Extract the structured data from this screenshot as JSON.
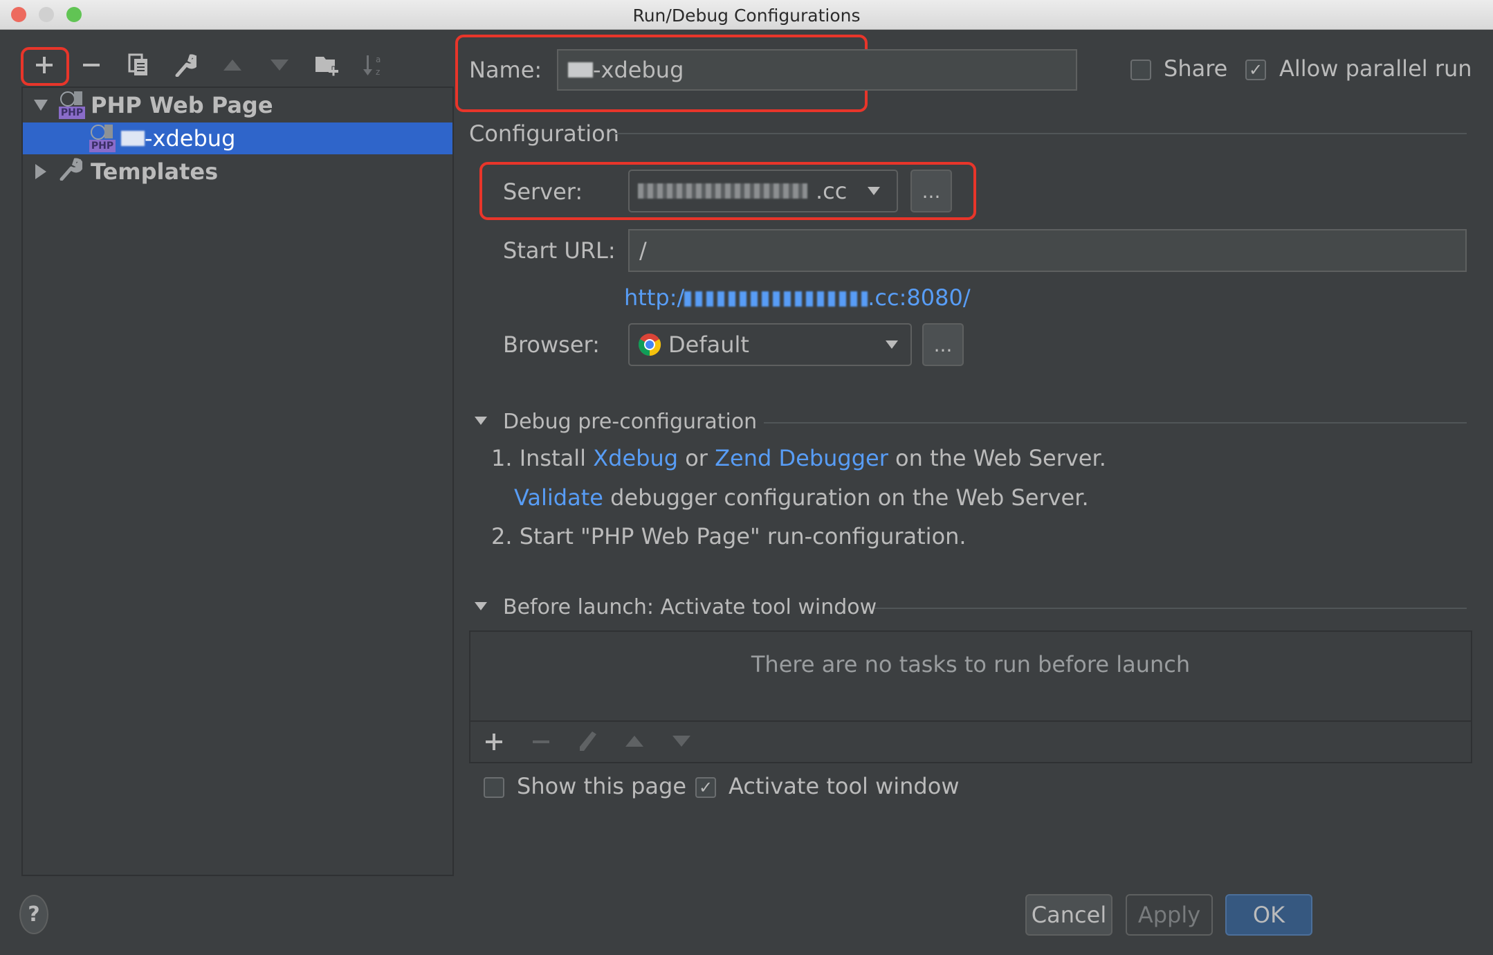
{
  "window": {
    "title": "Run/Debug Configurations",
    "traffic_lights": {
      "close": "#ed6a5e",
      "minimize": "#d0d0d0",
      "maximize": "#61c454"
    }
  },
  "toolbar": {
    "items": [
      {
        "name": "add",
        "glyph": "+"
      },
      {
        "name": "remove",
        "glyph": "−"
      },
      {
        "name": "copy",
        "glyph": "⧉"
      },
      {
        "name": "edit-defaults",
        "glyph": "🔧"
      },
      {
        "name": "move-up",
        "glyph": "▲"
      },
      {
        "name": "move-down",
        "glyph": "▼"
      },
      {
        "name": "new-folder",
        "glyph": "📁"
      },
      {
        "name": "sort",
        "glyph": "↓ᵃᶻ"
      }
    ]
  },
  "tree": {
    "group": {
      "label": "PHP Web Page",
      "expanded": true
    },
    "child": {
      "label": "-xdebug",
      "selected": true
    },
    "templates": {
      "label": "Templates",
      "expanded": false
    }
  },
  "form": {
    "name_label": "Name:",
    "name_value": "-xdebug",
    "share_label": "Share",
    "share_checked": false,
    "allow_parallel_label": "Allow parallel run",
    "allow_parallel_checked": true,
    "configuration_header": "Configuration",
    "server_label": "Server:",
    "server_value_suffix": ".cc",
    "ellipsis": "...",
    "start_url_label": "Start URL:",
    "start_url_value": "/",
    "resolved_url_prefix": "http:/",
    "resolved_url_suffix": ".cc:8080/",
    "browser_label": "Browser:",
    "browser_value": "Default"
  },
  "debug_preconfig": {
    "header": "Debug pre-configuration",
    "line1_prefix": "1. Install ",
    "line1_link1": "Xdebug",
    "line1_mid": " or ",
    "line1_link2": "Zend Debugger",
    "line1_suffix": " on the Web Server.",
    "line2_link": "Validate",
    "line2_suffix": " debugger configuration on the Web Server.",
    "line3": "2. Start \"PHP Web Page\" run-configuration."
  },
  "before_launch": {
    "header": "Before launch: Activate tool window",
    "empty_text": "There are no tasks to run before launch",
    "show_page_label": "Show this page",
    "show_page_checked": false,
    "activate_label": "Activate tool window",
    "activate_checked": true
  },
  "footer": {
    "help": "?",
    "cancel": "Cancel",
    "apply": "Apply",
    "ok": "OK"
  },
  "colors": {
    "background": "#3c3f41",
    "selection": "#2f65ca",
    "link": "#589df6",
    "annotation_red": "#e8352a",
    "ok_button": "#365880"
  }
}
